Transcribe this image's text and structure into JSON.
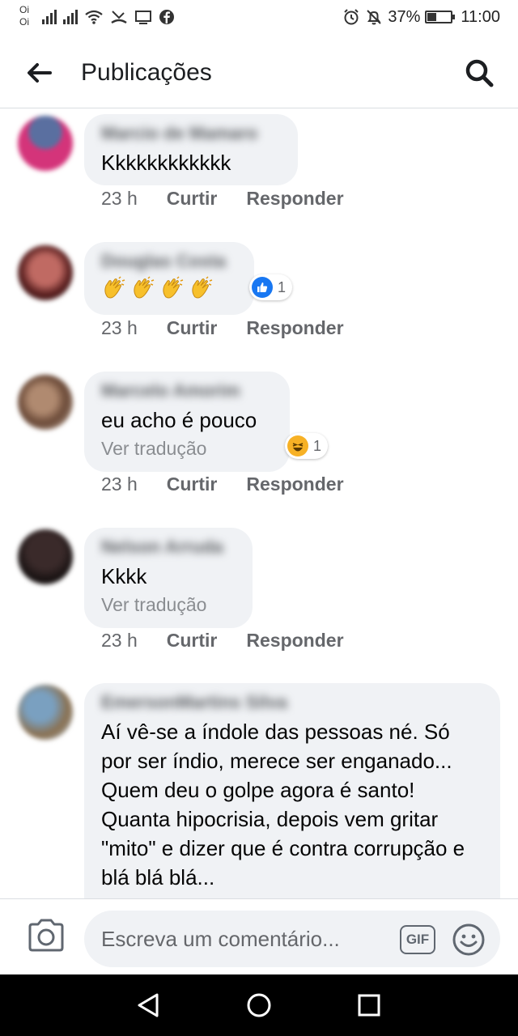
{
  "status_bar": {
    "carrier_1": "Oi",
    "carrier_2": "Oi",
    "battery_percent": "37%",
    "battery_level": 0.37,
    "time": "11:00"
  },
  "header": {
    "title": "Publicações",
    "back_icon": "arrow-left-icon",
    "search_icon": "search-icon"
  },
  "comments": [
    {
      "author": "Marcio de Mamaro",
      "text": "Kkkkkkkkkkkk",
      "time": "23 h",
      "like_label": "Curtir",
      "reply_label": "Responder"
    },
    {
      "author": "Douglas Costa",
      "text": "",
      "emoji": "clapping-hands x4",
      "reaction_type": "like",
      "reaction_count": "1",
      "time": "23 h",
      "like_label": "Curtir",
      "reply_label": "Responder"
    },
    {
      "author": "Marcelo Amorim",
      "text": "eu acho é pouco",
      "translate_label": "Ver tradução",
      "reaction_type": "haha",
      "reaction_count": "1",
      "time": "23 h",
      "like_label": "Curtir",
      "reply_label": "Responder"
    },
    {
      "author": "Nelson Arruda",
      "text": "Kkkk",
      "translate_label": "Ver tradução",
      "time": "23 h",
      "like_label": "Curtir",
      "reply_label": "Responder"
    },
    {
      "author": "EmersonMartins Silva",
      "text": "Aí vê-se a índole das pessoas né. Só por ser índio, merece ser enganado... Quem deu o golpe agora é santo! Quanta hipocrisia, depois vem gritar \"mito\" e dizer que é contra corrupção e blá blá blá..."
    }
  ],
  "composer": {
    "placeholder": "Escreva um comentário...",
    "gif_label": "GIF",
    "camera_icon": "camera-icon",
    "emoji_icon": "smiley-icon"
  },
  "colors": {
    "bubble_bg": "#f0f2f5",
    "like_blue": "#1877f2",
    "meta_gray": "#65676b"
  }
}
